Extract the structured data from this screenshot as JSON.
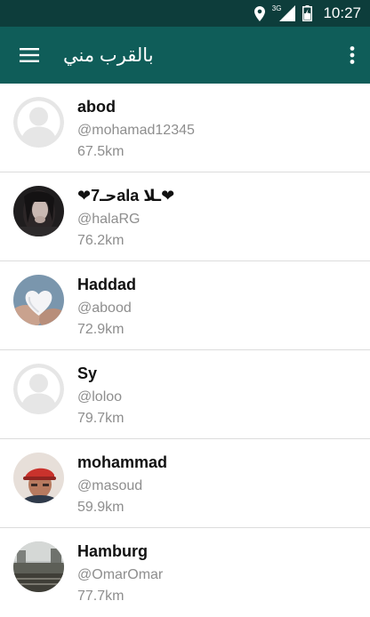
{
  "status_bar": {
    "time": "10:27",
    "network": "3G",
    "icons": [
      "location-icon",
      "signal-icon",
      "battery-icon"
    ]
  },
  "app_bar": {
    "title": "بالقرب مني",
    "menu_icon": "hamburger-icon",
    "more_icon": "more-vert-icon",
    "color": "#0f5d59"
  },
  "users": [
    {
      "name": "abod",
      "handle": "@mohamad12345",
      "distance": "67.5km",
      "avatar": "placeholder"
    },
    {
      "name": "❤حـ7ala ـلا❤",
      "handle": "@halaRG",
      "distance": "76.2km",
      "avatar": "photo-woman"
    },
    {
      "name": "Haddad",
      "handle": "@abood",
      "distance": "72.9km",
      "avatar": "photo-heart"
    },
    {
      "name": "Sy",
      "handle": "@loloo",
      "distance": "79.7km",
      "avatar": "placeholder"
    },
    {
      "name": "mohammad",
      "handle": "@masoud",
      "distance": "59.9km",
      "avatar": "photo-man"
    },
    {
      "name": "Hamburg",
      "handle": "@OmarOmar",
      "distance": "77.7km",
      "avatar": "photo-city"
    }
  ]
}
